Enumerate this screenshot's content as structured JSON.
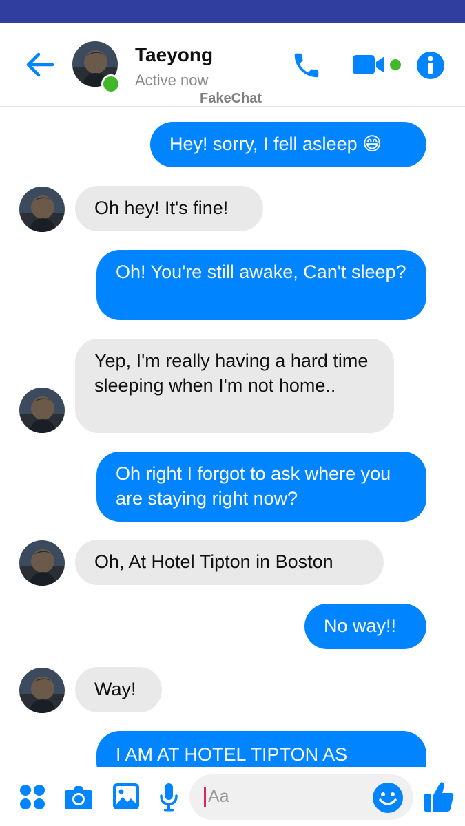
{
  "contact": {
    "name": "Taeyong",
    "status": "Active now"
  },
  "watermark": "FakeChat",
  "colors": {
    "statusbar": "#303f9f",
    "accent": "#0084ff",
    "incoming_bubble": "#e9e9e9",
    "online": "#42b72a"
  },
  "header_icons": [
    "back-arrow-icon",
    "phone-icon",
    "video-camera-icon",
    "info-icon"
  ],
  "messages": [
    {
      "from": "me",
      "text": "Hey! sorry, I fell asleep 😅"
    },
    {
      "from": "them",
      "text": "Oh hey! It's fine!"
    },
    {
      "from": "me",
      "text": "Oh! You're still awake, Can't sleep?"
    },
    {
      "from": "them",
      "text": "Yep, I'm really having a hard time sleeping when I'm not home.."
    },
    {
      "from": "me",
      "text": "Oh right I forgot to ask where you are staying right now?"
    },
    {
      "from": "them",
      "text": "Oh, At Hotel Tipton in Boston"
    },
    {
      "from": "me",
      "text": "No way!!"
    },
    {
      "from": "them",
      "text": "Way!"
    },
    {
      "from": "me",
      "text": "I AM AT HOTEL TIPTON AS"
    }
  ],
  "composer": {
    "placeholder": "Aa",
    "icons": [
      "apps-icon",
      "camera-icon",
      "image-icon",
      "microphone-icon",
      "emoji-icon",
      "like-icon"
    ]
  }
}
